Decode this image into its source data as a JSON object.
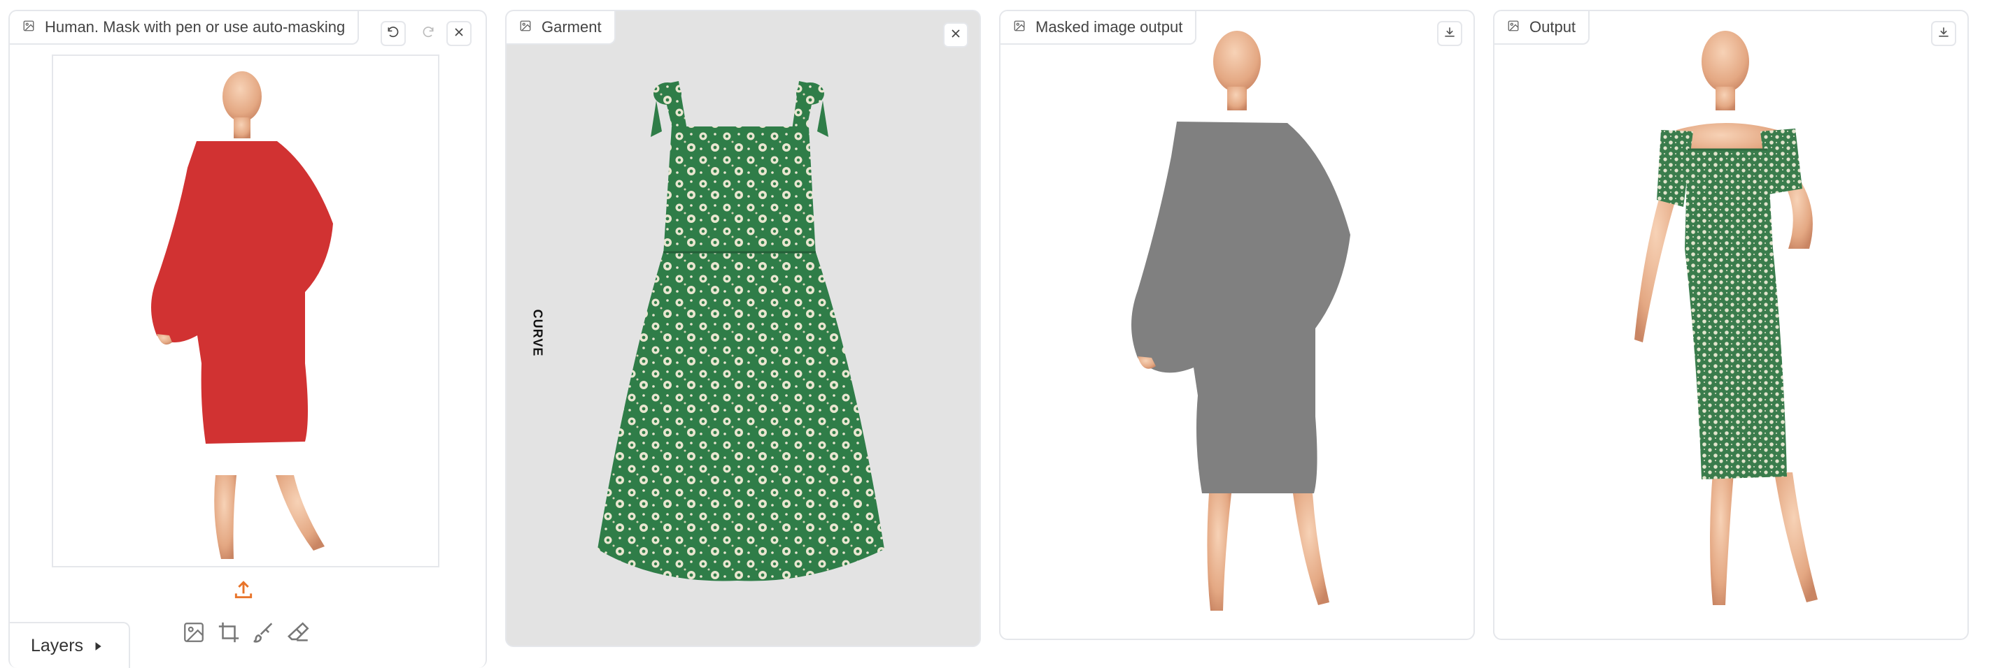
{
  "panels": {
    "human": {
      "label": "Human. Mask with pen or use auto-masking",
      "layers_label": "Layers"
    },
    "garment": {
      "label": "Garment",
      "brand_text": "CURVE"
    },
    "masked": {
      "label": "Masked image output"
    },
    "output": {
      "label": "Output"
    }
  },
  "colors": {
    "mask_red": "#d13232",
    "mask_gray": "#808080",
    "dress_green": "#2e7a45",
    "upload_orange": "#e8742a",
    "garment_bg": "#e3e3e3"
  },
  "icons": [
    "image-icon",
    "undo-icon",
    "redo-icon",
    "close-icon",
    "download-icon",
    "upload-icon",
    "crop-icon",
    "brush-icon",
    "eraser-icon",
    "caret-right-icon"
  ]
}
